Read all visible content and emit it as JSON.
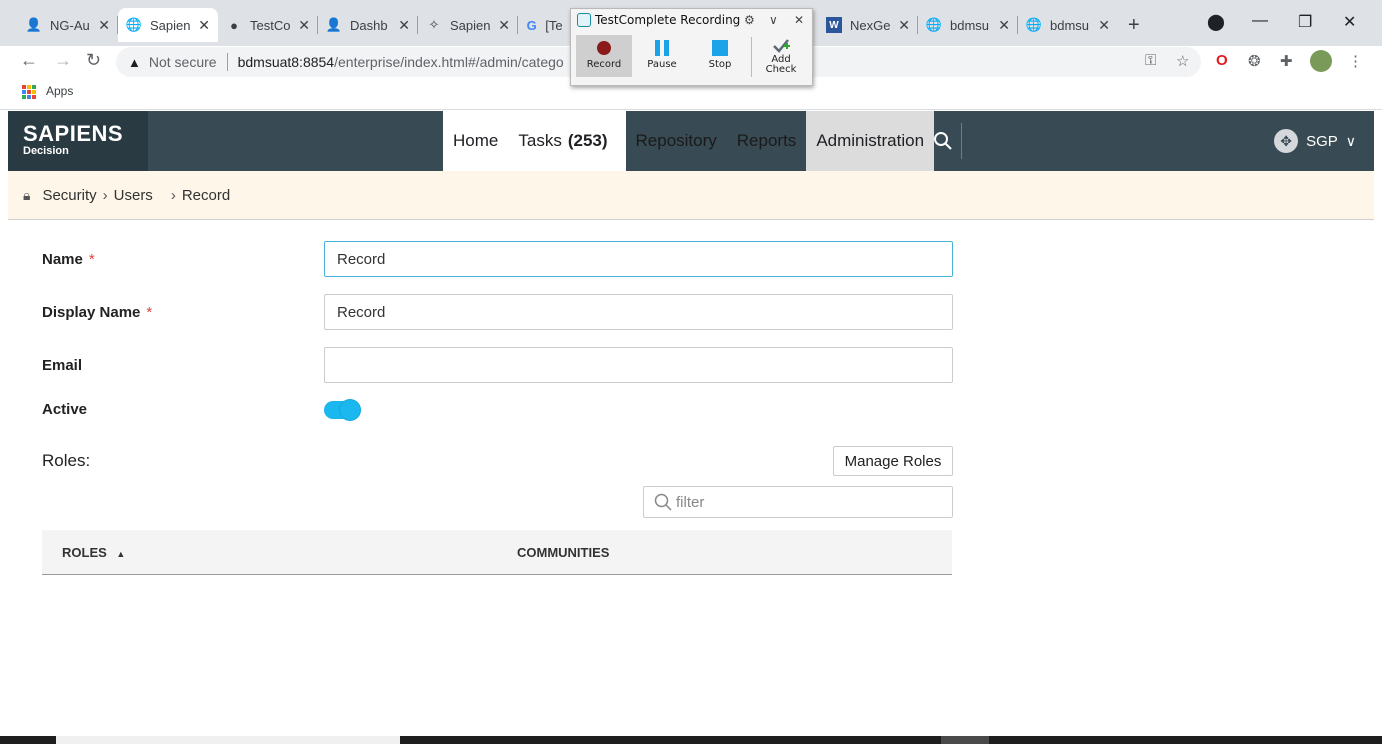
{
  "browser": {
    "tabs": [
      {
        "title": "NG-Au",
        "icon": "person-avatar-icon"
      },
      {
        "title": "Sapien",
        "icon": "globe-icon",
        "active": true
      },
      {
        "title": "TestCo",
        "icon": "github-icon"
      },
      {
        "title": "Dashb",
        "icon": "person-avatar-icon"
      },
      {
        "title": "Sapien",
        "icon": "sapiens-icon"
      },
      {
        "title": "[Tes",
        "icon": "google-icon"
      },
      {
        "title": "NexGe",
        "icon": "word-icon"
      },
      {
        "title": "bdmsu",
        "icon": "globe-icon"
      },
      {
        "title": "bdmsu",
        "icon": "globe-icon"
      }
    ],
    "address": {
      "security": "Not secure",
      "host": "bdmsuat8:8854",
      "path": "/enterprise/index.html#/admin/catego"
    },
    "bookmarks": {
      "apps_label": "Apps"
    }
  },
  "testcomplete": {
    "title": "TestComplete Recording",
    "buttons": {
      "record": "Record",
      "pause": "Pause",
      "stop": "Stop",
      "add_check_1": "Add",
      "add_check_2": "Check"
    }
  },
  "app": {
    "logo": {
      "brand": "SAPIENS",
      "sub": "Decision"
    },
    "nav": {
      "home": "Home",
      "tasks": "Tasks",
      "tasks_count": "(253)",
      "repository": "Repository",
      "reports": "Reports",
      "administration": "Administration"
    },
    "user": {
      "label": "SGP"
    }
  },
  "breadcrumb": {
    "security": "Security",
    "users": "Users",
    "current": "Record"
  },
  "form": {
    "name_label": "Name",
    "name_value": "Record",
    "display_name_label": "Display Name",
    "display_name_value": "Record",
    "email_label": "Email",
    "email_value": "",
    "active_label": "Active",
    "active": true,
    "required_mark": "*"
  },
  "roles": {
    "label": "Roles:",
    "manage_button": "Manage Roles",
    "filter_placeholder": "filter",
    "columns": {
      "roles": "ROLES",
      "communities": "COMMUNITIES"
    },
    "sort_indicator": "▲"
  },
  "colors": {
    "header_bg": "#384a53",
    "breadcrumb_bg": "#fdf6e9",
    "toggle": "#1bb8f0",
    "required": "#e2453c"
  }
}
